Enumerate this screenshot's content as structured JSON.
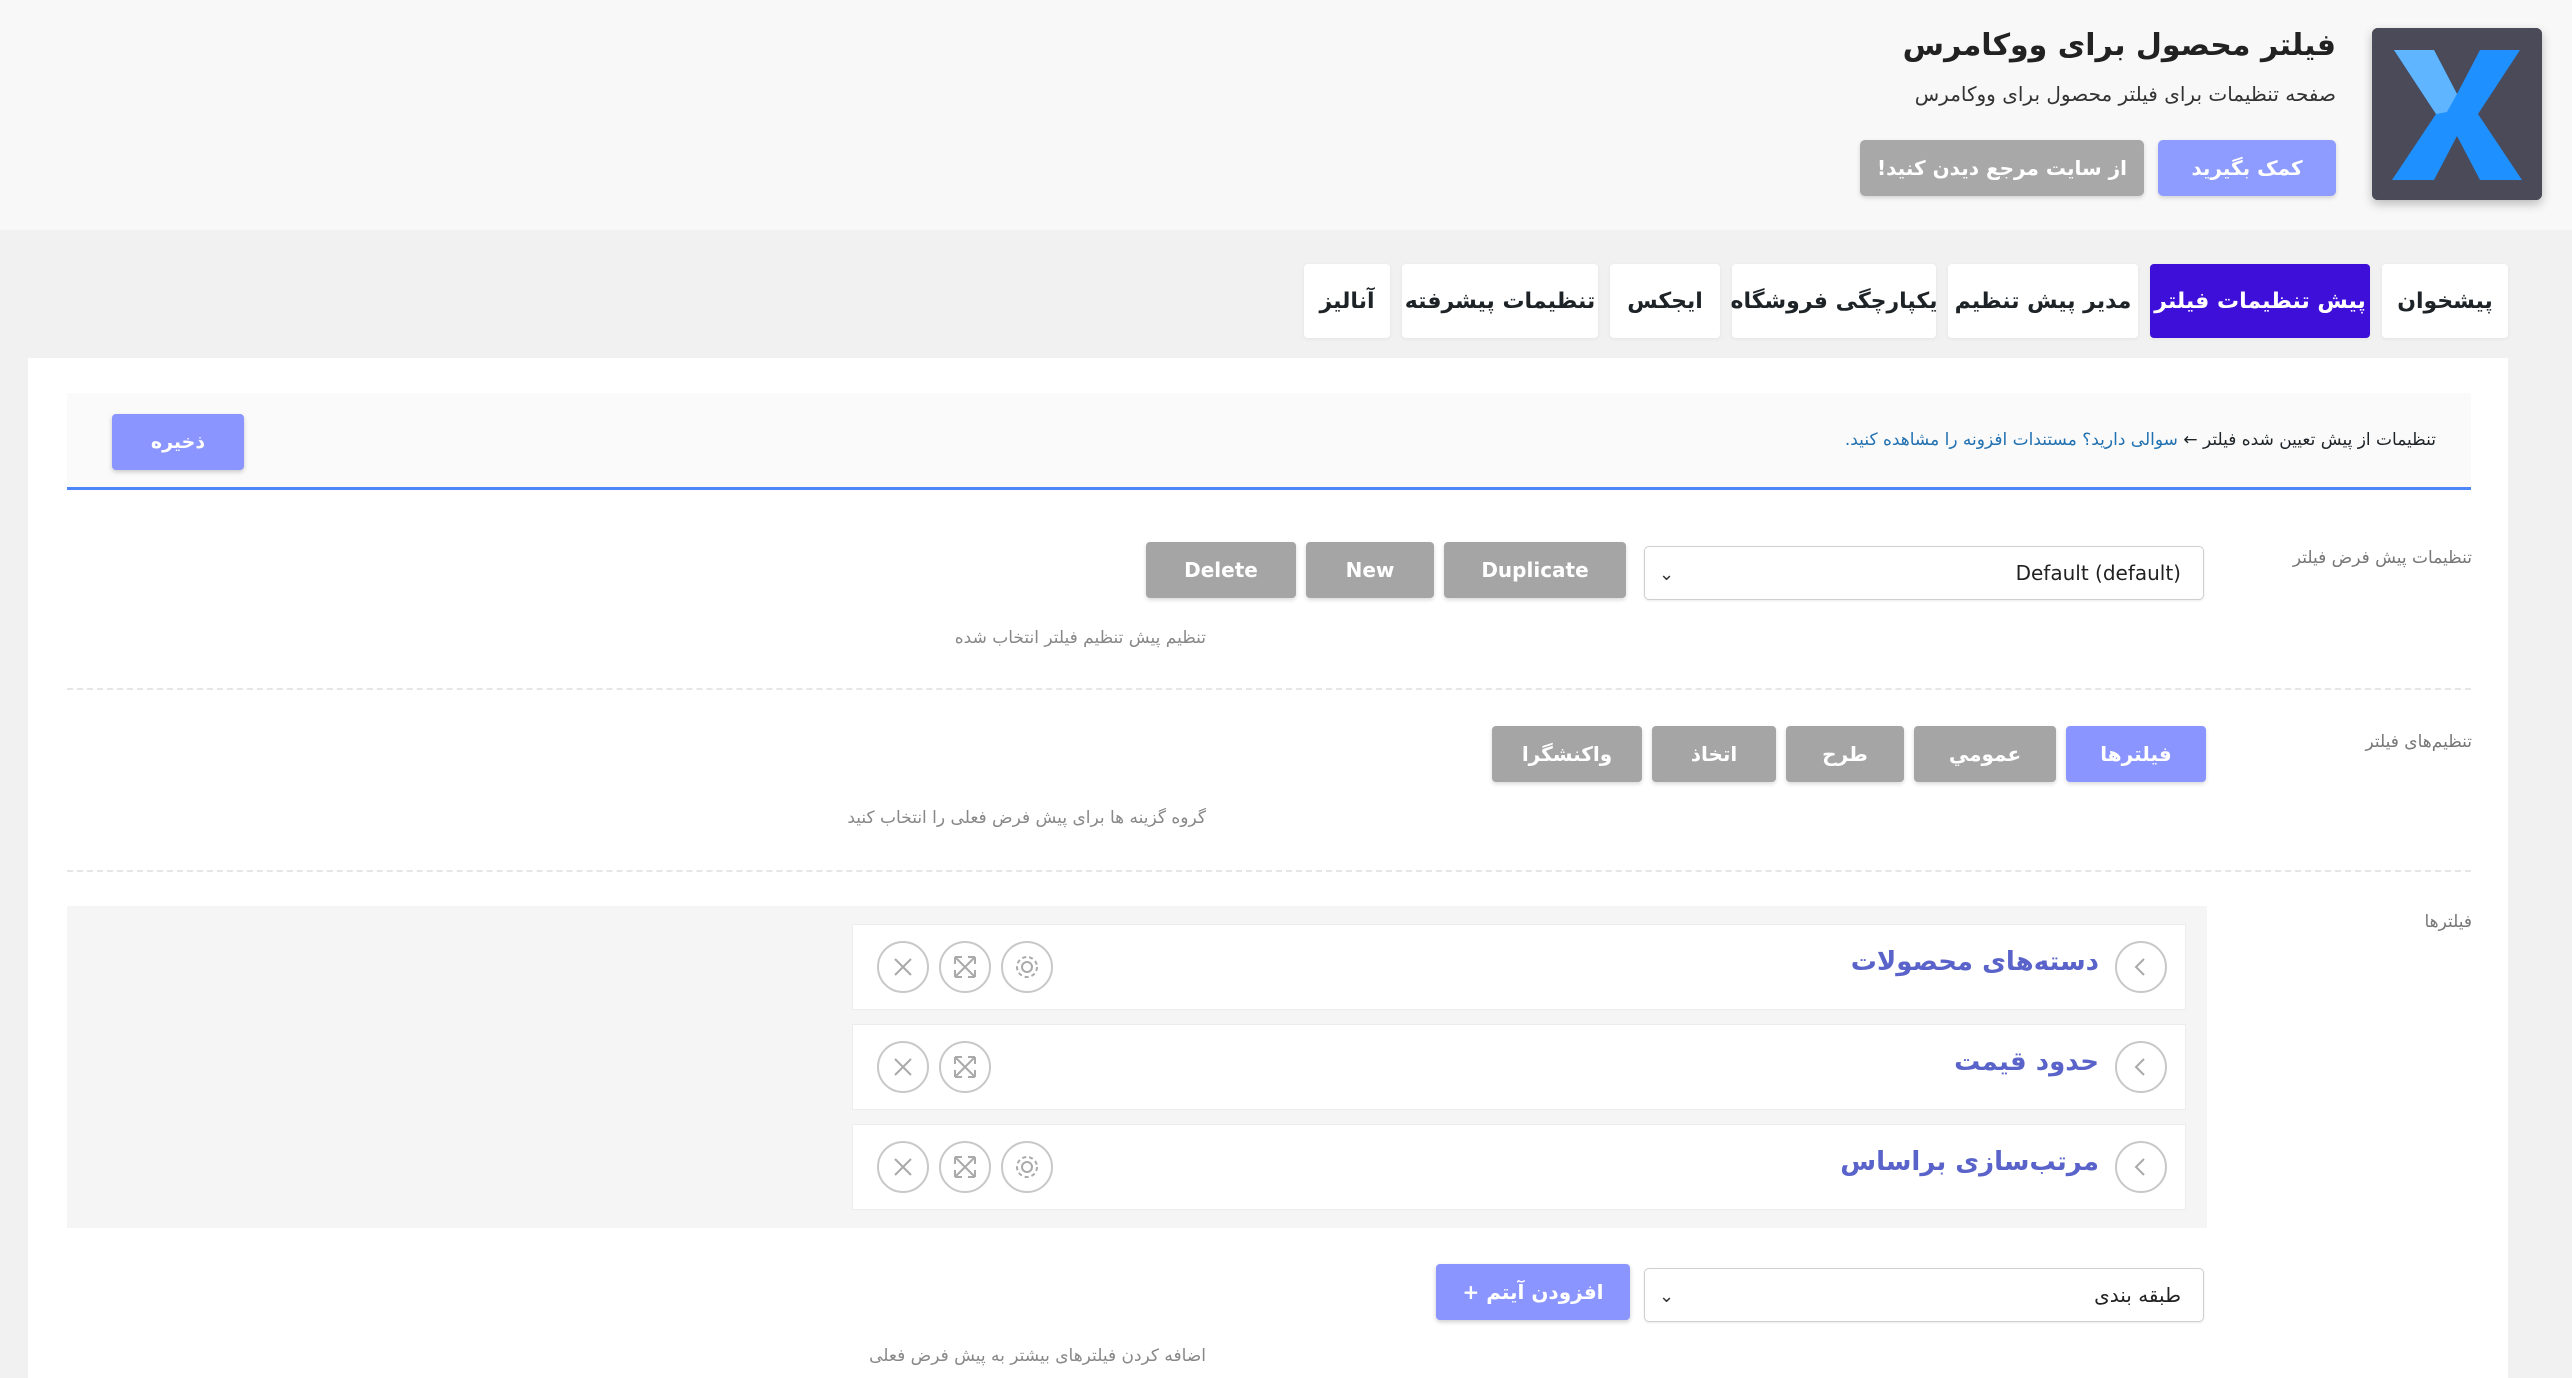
{
  "header": {
    "title": "فیلتر محصول برای ووکامرس",
    "subtitle": "صفحه تنظیمات برای فیلتر محصول برای ووکامرس",
    "help_label": "کمک بگیرید",
    "docs_label": "از سایت مرجع دیدن کنید!",
    "logo_letter": "X",
    "logo_colors": {
      "background": "#4a4a58",
      "letter": "#1e90ff"
    }
  },
  "tabs": [
    {
      "label": "پیشخوان",
      "active": false
    },
    {
      "label": "پیش تنظیمات فیلتر",
      "active": true
    },
    {
      "label": "مدیر پیش تنظیم",
      "active": false
    },
    {
      "label": "یکپارچگی فروشگاه",
      "active": false
    },
    {
      "label": "ایجکس",
      "active": false
    },
    {
      "label": "تنظیمات پیشرفته",
      "active": false
    },
    {
      "label": "آنالیز",
      "active": false
    }
  ],
  "notice": {
    "breadcrumb_text": "تنظیمات از پیش تعیین شده فیلتر",
    "arrow": "←",
    "link_text": "سوالی دارید؟ مستندات افزونه را مشاهده کنید.",
    "save_label": "ذخیره"
  },
  "preset": {
    "label": "تنظیمات پیش فرض فیلتر",
    "selected": "Default (default)",
    "description": "تنظیم پیش تنظیم فیلتر انتخاب شده",
    "buttons": {
      "duplicate": "Duplicate",
      "new": "New",
      "delete": "Delete"
    }
  },
  "filter_settings": {
    "label": "تنظیم‌های فیلتر",
    "groups": [
      {
        "label": "فیلترها",
        "active": true
      },
      {
        "label": "عمومي",
        "active": false
      },
      {
        "label": "طرح",
        "active": false
      },
      {
        "label": "اتخاذ",
        "active": false
      },
      {
        "label": "واکنشگرا",
        "active": false
      }
    ],
    "description": "گروه گزینه ها برای پیش فرض فعلی را انتخاب کنید"
  },
  "filters": {
    "label": "فیلترها",
    "items": [
      {
        "title": "دسته‌های محصولات",
        "has_settings": true
      },
      {
        "title": "حدود قیمت",
        "has_settings": false
      },
      {
        "title": "مرتب‌سازی براساس",
        "has_settings": true
      }
    ],
    "add_select": "طبقه بندی",
    "add_label": "افزودن آیتم +",
    "add_description": "اضافه کردن فیلترهای بیشتر به پیش فرض فعلی"
  },
  "colors": {
    "accent": "#8b95ff",
    "active_tab": "#3e0fd8",
    "link": "#2271b1",
    "filter_title": "#5a63c9"
  }
}
